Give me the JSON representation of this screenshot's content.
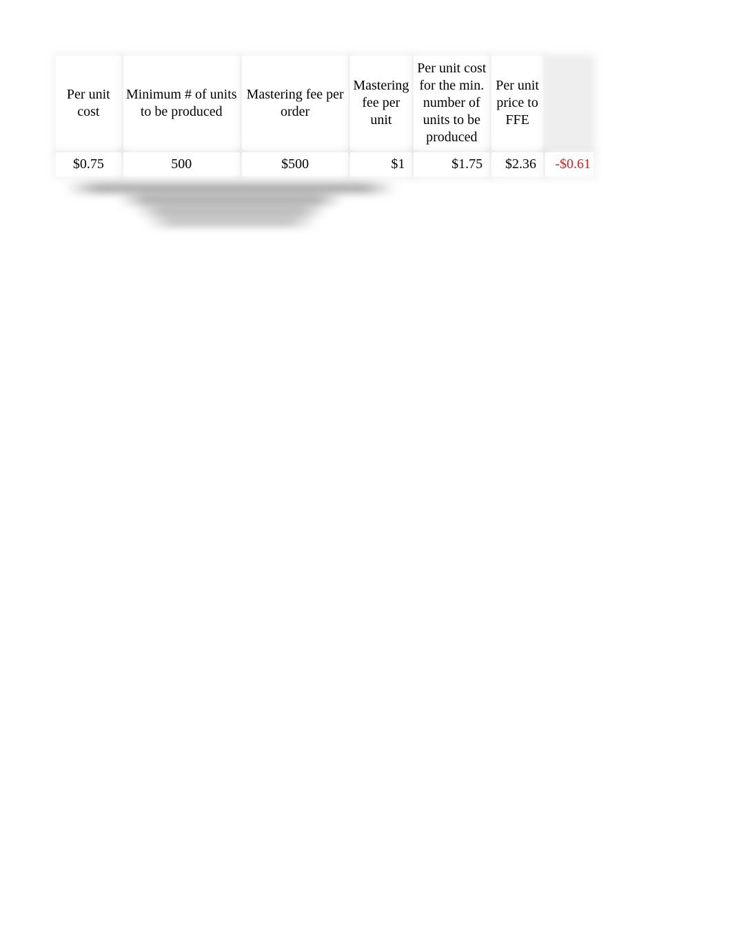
{
  "table": {
    "headers": [
      "Per unit cost",
      "Minimum # of units to be produced",
      "Mastering fee per order",
      "Mastering fee per unit",
      "Per unit cost for the min. number of units to be produced",
      "Per unit price to FFE",
      ""
    ],
    "rows": [
      {
        "per_unit_cost": "$0.75",
        "min_units": "500",
        "mastering_fee_order": "$500",
        "mastering_fee_unit": "$1",
        "per_unit_cost_min": "$1.75",
        "per_unit_price_ffe": "$2.36",
        "last": "-$0.61",
        "last_negative": true
      }
    ]
  }
}
